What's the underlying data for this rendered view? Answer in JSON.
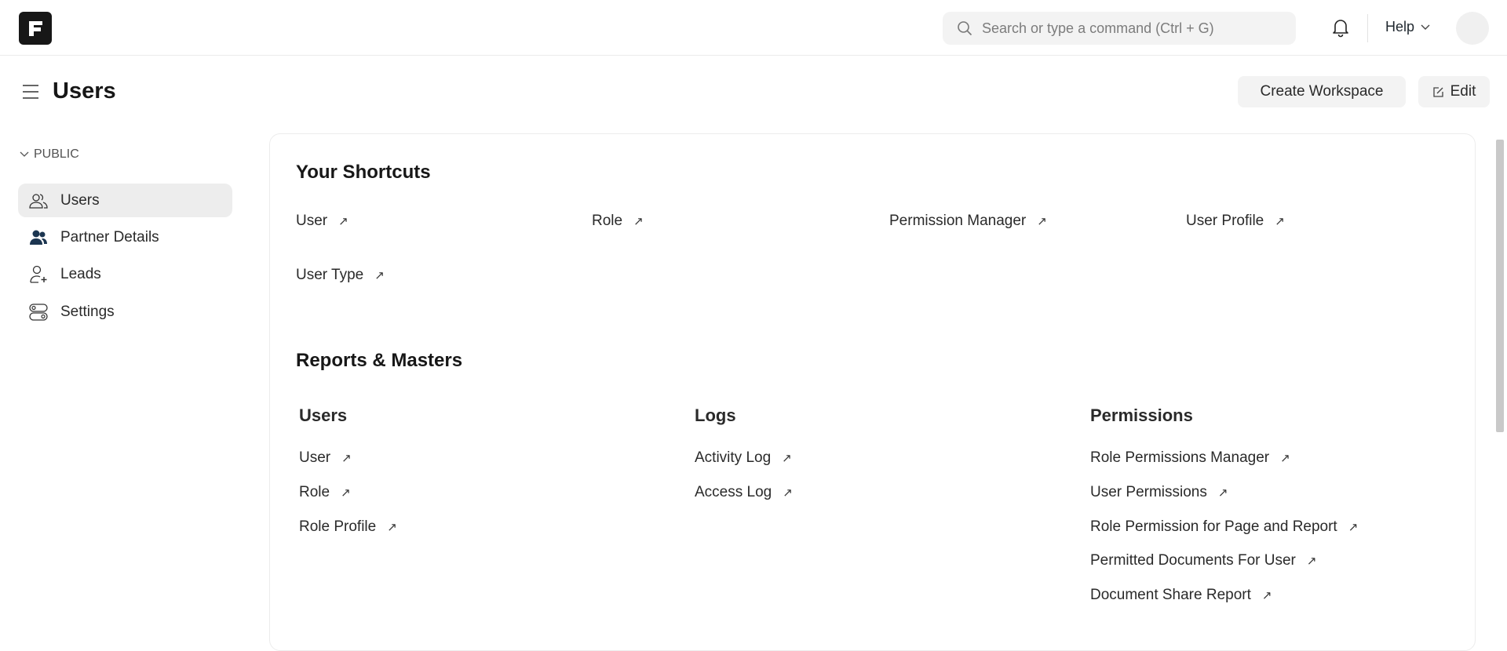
{
  "topbar": {
    "search_placeholder": "Search or type a command (Ctrl + G)",
    "help_label": "Help"
  },
  "page": {
    "title": "Users",
    "create_workspace_label": "Create Workspace",
    "edit_label": "Edit"
  },
  "sidebar": {
    "section_label": "PUBLIC",
    "items": [
      {
        "label": "Users",
        "icon": "users-icon",
        "active": true
      },
      {
        "label": "Partner Details",
        "icon": "group-icon"
      },
      {
        "label": "Leads",
        "icon": "user-plus-icon"
      },
      {
        "label": "Settings",
        "icon": "toggles-icon"
      }
    ]
  },
  "shortcuts": {
    "title": "Your Shortcuts",
    "items": [
      "User",
      "Role",
      "Permission Manager",
      "User Profile",
      "User Type"
    ]
  },
  "reports": {
    "title": "Reports & Masters",
    "columns": [
      {
        "title": "Users",
        "links": [
          "User",
          "Role",
          "Role Profile"
        ]
      },
      {
        "title": "Logs",
        "links": [
          "Activity Log",
          "Access Log"
        ]
      },
      {
        "title": "Permissions",
        "links": [
          "Role Permissions Manager",
          "User Permissions",
          "Role Permission for Page and Report",
          "Permitted Documents For User",
          "Document Share Report"
        ]
      }
    ]
  },
  "arrow_glyph": "↗"
}
